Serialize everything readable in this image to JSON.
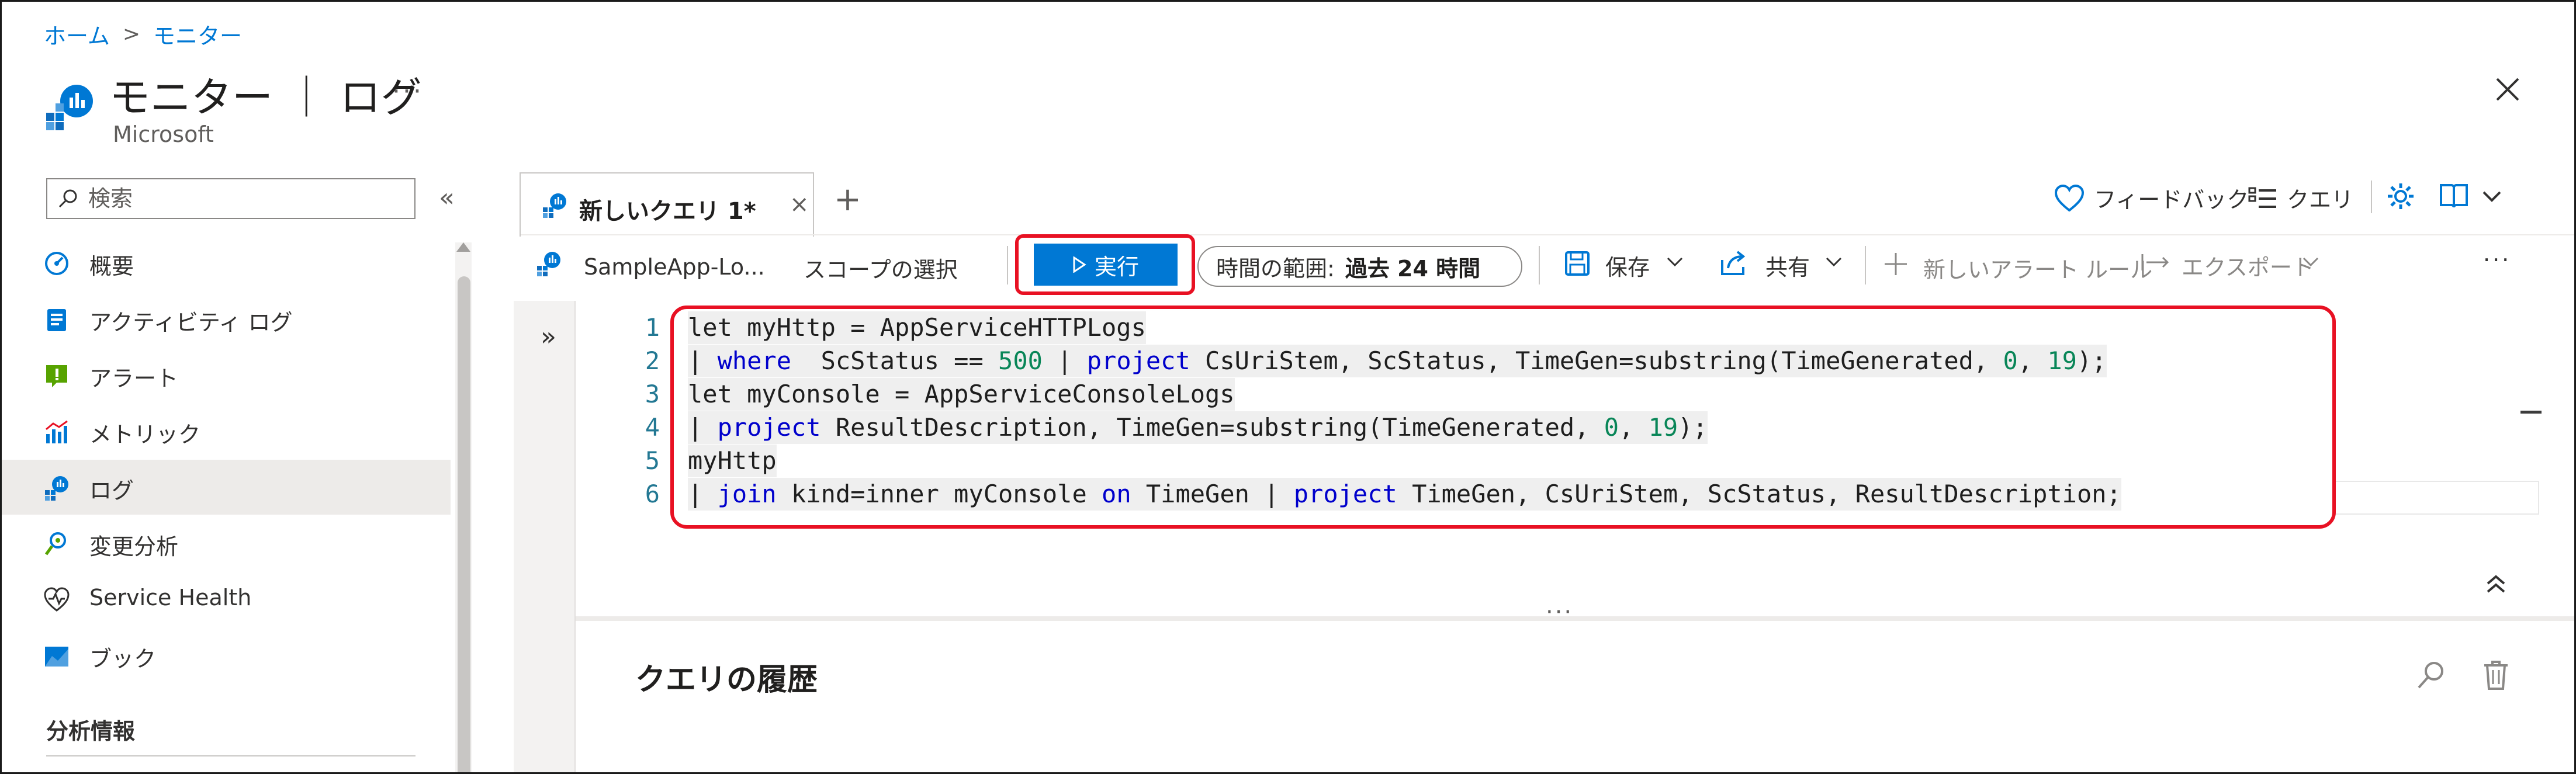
{
  "breadcrumb": {
    "home": "ホーム",
    "separator": ">",
    "current": "モニター"
  },
  "header": {
    "title": "モニター ｜ ログ",
    "subtitle": "Microsoft",
    "more": "···"
  },
  "sidebar": {
    "search_placeholder": "検索",
    "collapse": "«",
    "items": [
      {
        "label": "概要",
        "icon": "gauge-icon"
      },
      {
        "label": "アクティビティ ログ",
        "icon": "activity-log-icon"
      },
      {
        "label": "アラート",
        "icon": "alert-icon"
      },
      {
        "label": "メトリック",
        "icon": "metrics-icon"
      },
      {
        "label": "ログ",
        "icon": "logs-icon",
        "active": true
      },
      {
        "label": "変更分析",
        "icon": "change-analysis-icon"
      },
      {
        "label": "Service Health",
        "icon": "heart-icon"
      },
      {
        "label": "ブック",
        "icon": "workbook-icon"
      }
    ],
    "section_title": "分析情報"
  },
  "tabs": {
    "active_label": "新しいクエリ 1*",
    "close": "×",
    "add": "+"
  },
  "top_actions": {
    "feedback": "フィードバック",
    "queries": "クエリ"
  },
  "toolbar": {
    "scope": "SampleApp-Lo...",
    "scope_select": "スコープの選択",
    "run": "実行",
    "time_range_label": "時間の範囲:",
    "time_range_value": "過去 24 時間",
    "save": "保存",
    "share": "共有",
    "new_alert": "新しいアラート ルール",
    "export": "エクスポート",
    "more": "···"
  },
  "editor": {
    "line_numbers": [
      "1",
      "2",
      "3",
      "4",
      "5",
      "6"
    ],
    "lines": {
      "l1": "let myHttp = AppServiceHTTPLogs",
      "l2_a": "| ",
      "l2_kw1": "where",
      "l2_b": "  ScStatus == ",
      "l2_num1": "500",
      "l2_c": " | ",
      "l2_kw2": "project",
      "l2_d": " CsUriStem, ScStatus, TimeGen=substring(TimeGenerated, ",
      "l2_num2": "0",
      "l2_e": ", ",
      "l2_num3": "19",
      "l2_f": ");",
      "l3": "let myConsole = AppServiceConsoleLogs",
      "l4_a": "| ",
      "l4_kw1": "project",
      "l4_b": " ResultDescription, TimeGen=substring(TimeGenerated, ",
      "l4_num1": "0",
      "l4_c": ", ",
      "l4_num2": "19",
      "l4_d": ");",
      "l5": "myHttp",
      "l6_a": "| ",
      "l6_kw1": "join",
      "l6_b": " kind=inner myConsole ",
      "l6_kw2": "on",
      "l6_c": " TimeGen | ",
      "l6_kw3": "project",
      "l6_d": " TimeGen, CsUriStem, ScStatus, ResultDescription;"
    },
    "splitter": "···"
  },
  "history": {
    "title": "クエリの履歴"
  },
  "colors": {
    "accent": "#0078d4",
    "highlight": "#e81123",
    "keyword": "#0000cc",
    "number": "#098658"
  }
}
